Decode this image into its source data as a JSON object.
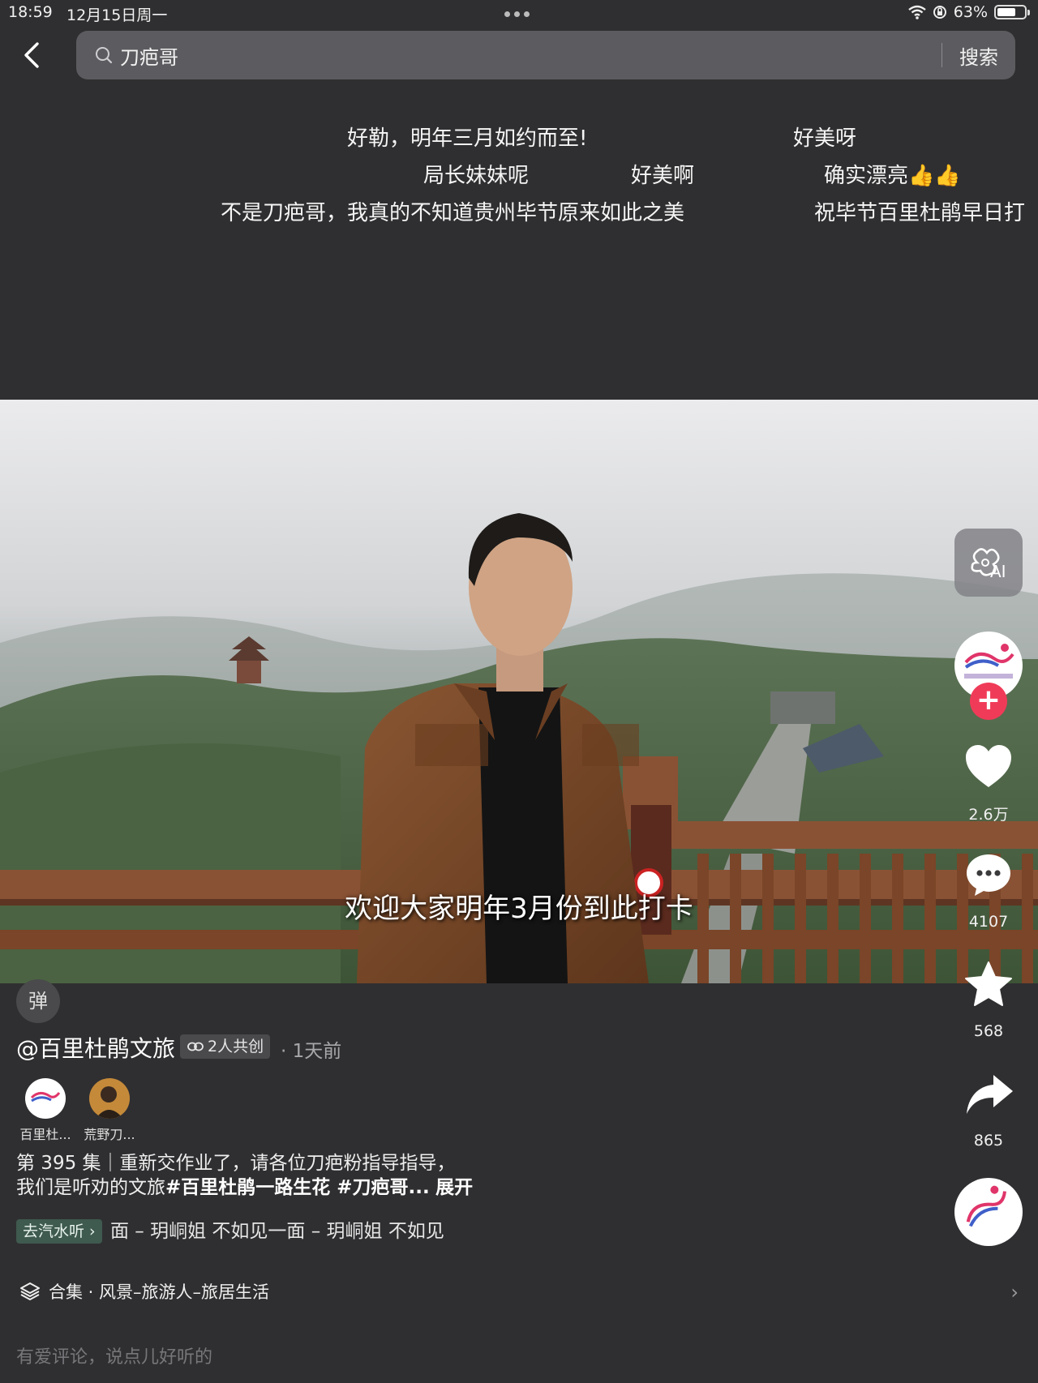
{
  "status_bar": {
    "time": "18:59",
    "date": "12月15日周一",
    "battery_text": "63%",
    "battery_level": 0.63
  },
  "search": {
    "query": "刀疤哥",
    "button_label": "搜索"
  },
  "danmaku": [
    "好勒，明年三月如约而至!",
    "好美呀",
    "局长妹妹呢",
    "好美啊",
    "确实漂亮👍👍",
    "不是刀疤哥，我真的不知道贵州毕节原来如此之美",
    "祝毕节百里杜鹃早日打"
  ],
  "video": {
    "subtitle": "欢迎大家明年3月份到此打卡"
  },
  "rail": {
    "ai_label": "AI",
    "likes": "2.6万",
    "comments": "4107",
    "favorites": "568",
    "shares": "865"
  },
  "info": {
    "danmaku_toggle": "弹",
    "author": "@百里杜鹃文旅",
    "cocreate": "2人共创",
    "time_ago": "· 1天前",
    "creators": [
      {
        "name": "百里杜..."
      },
      {
        "name": "荒野刀..."
      }
    ],
    "desc_line1": "第 395 集｜重新交作业了，请各位刀疤粉指导指导，",
    "desc_line2_plain": "我们是听劝的文旅",
    "desc_line2_tags": "#百里杜鹃一路生花 #刀疤哥...",
    "expand": "展开",
    "music_tag": "去汽水听",
    "music_scroll": "面 – 玥峒姐    不如见一面 – 玥峒姐    不如见",
    "collection": "合集 · 风景–旅游人–旅居生活",
    "comment_placeholder": "有爱评论，说点儿好听的"
  },
  "colors": {
    "background": "#2f2f31",
    "follow_red": "#f03b58",
    "music_tag_bg": "#3f5a4e"
  }
}
